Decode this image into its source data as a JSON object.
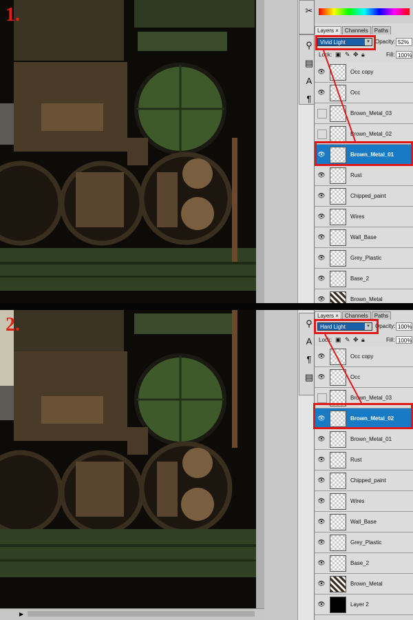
{
  "steps": [
    {
      "number": "1.",
      "tabs": [
        "Layers ×",
        "Channels",
        "Paths"
      ],
      "active_tab": 0,
      "blend_mode": "Vivid Light",
      "opacity_label": "Opacity:",
      "opacity_value": "52%",
      "lock_label": "Lock:",
      "fill_label": "Fill:",
      "fill_value": "100%",
      "layers": [
        {
          "name": "Occ copy",
          "visible": true,
          "thumb": "checker"
        },
        {
          "name": "Occ",
          "visible": true,
          "thumb": "checker"
        },
        {
          "name": "Brown_Metal_03",
          "visible": false,
          "thumb": "checker"
        },
        {
          "name": "Brown_Metal_02",
          "visible": false,
          "thumb": "checker"
        },
        {
          "name": "Brown_Metal_01",
          "visible": true,
          "thumb": "checker",
          "selected": true
        },
        {
          "name": "Rust",
          "visible": true,
          "thumb": "checker"
        },
        {
          "name": "Chipped_paint",
          "visible": true,
          "thumb": "checker"
        },
        {
          "name": "Wires",
          "visible": true,
          "thumb": "checker"
        },
        {
          "name": "Wall_Base",
          "visible": true,
          "thumb": "checker"
        },
        {
          "name": "Grey_Plastic",
          "visible": true,
          "thumb": "checker"
        },
        {
          "name": "Base_2",
          "visible": true,
          "thumb": "checker"
        },
        {
          "name": "Brown_Metal",
          "visible": true,
          "thumb": "pattern"
        }
      ]
    },
    {
      "number": "2.",
      "tabs": [
        "Layers ×",
        "Channels",
        "Paths"
      ],
      "active_tab": 0,
      "blend_mode": "Hard Light",
      "opacity_label": "Opacity:",
      "opacity_value": "100%",
      "lock_label": "Lock:",
      "fill_label": "Fill:",
      "fill_value": "100%",
      "layers": [
        {
          "name": "Occ copy",
          "visible": true,
          "thumb": "checker"
        },
        {
          "name": "Occ",
          "visible": true,
          "thumb": "checker"
        },
        {
          "name": "Brown_Metal_03",
          "visible": false,
          "thumb": "checker"
        },
        {
          "name": "Brown_Metal_02",
          "visible": true,
          "thumb": "checker",
          "selected": true
        },
        {
          "name": "Brown_Metal_01",
          "visible": true,
          "thumb": "checker"
        },
        {
          "name": "Rust",
          "visible": true,
          "thumb": "checker"
        },
        {
          "name": "Chipped_paint",
          "visible": true,
          "thumb": "checker"
        },
        {
          "name": "Wires",
          "visible": true,
          "thumb": "checker"
        },
        {
          "name": "Wall_Base",
          "visible": true,
          "thumb": "checker"
        },
        {
          "name": "Grey_Plastic",
          "visible": true,
          "thumb": "checker"
        },
        {
          "name": "Base_2",
          "visible": true,
          "thumb": "checker"
        },
        {
          "name": "Brown_Metal",
          "visible": true,
          "thumb": "pattern"
        },
        {
          "name": "Layer 2",
          "visible": true,
          "thumb": "dark"
        }
      ]
    }
  ],
  "colors": {
    "highlight": "#e01818",
    "selection": "#1879c4",
    "blend_select": "#1a5ea8",
    "panel_bg": "#d9d9d9"
  },
  "icons": {
    "eye": "eye-icon",
    "lock_transparent": "lock-transparent-icon",
    "lock_paint": "brush-icon",
    "lock_move": "move-icon",
    "lock_all": "lock-icon"
  }
}
